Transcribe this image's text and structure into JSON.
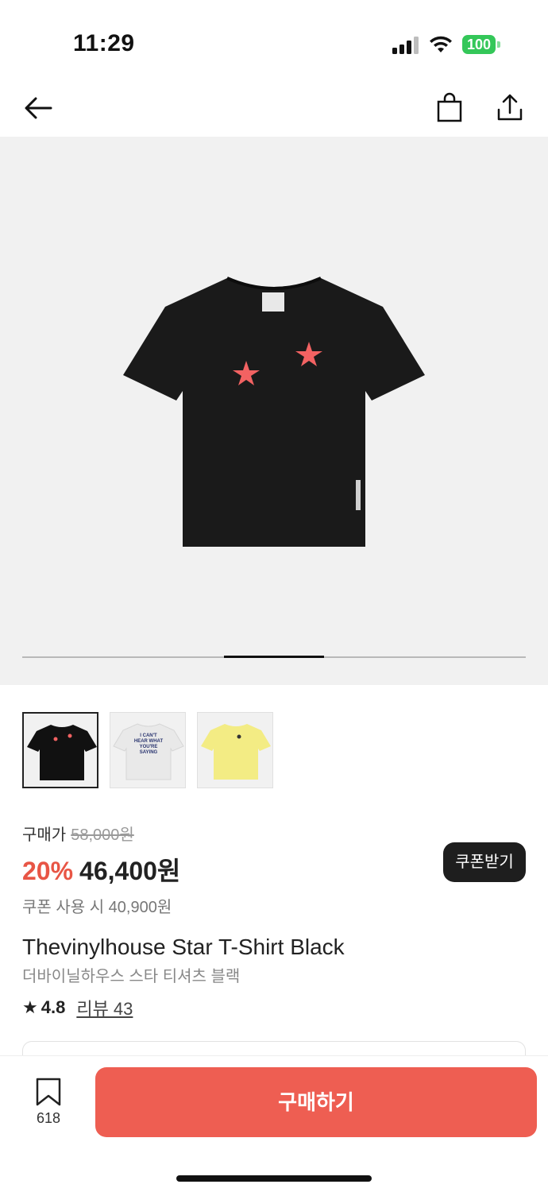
{
  "status_bar": {
    "time": "11:29",
    "battery": "100",
    "battery_color": "#34c759"
  },
  "nav": {
    "back_icon": "arrow-left-icon",
    "bag_icon": "shopping-bag-icon",
    "share_icon": "share-icon"
  },
  "hero": {
    "image_desc": "black t-shirt with two red stars",
    "carousel_position": 0.4
  },
  "thumbnails": [
    {
      "label": "black star tee",
      "selected": true,
      "print_text": ""
    },
    {
      "label": "white graphic tee",
      "selected": false,
      "print_text": "I CAN'T HEAR WHAT YOU'RE SAYING"
    },
    {
      "label": "yellow star tee",
      "selected": false,
      "print_text": ""
    }
  ],
  "price": {
    "label": "구매가",
    "original": "58,000원",
    "discount": "20%",
    "final": "46,400원",
    "coupon_text": "쿠폰 사용 시 40,900원",
    "coupon_button": "쿠폰받기",
    "accent_color": "#e85545"
  },
  "product": {
    "title": "Thevinylhouse Star T-Shirt Black",
    "subtitle": "더바이닐하우스 스타 티셔츠 블랙",
    "rating": "4.8",
    "review_label": "리뷰 43"
  },
  "bottom_bar": {
    "bookmark_count": "618",
    "buy_label": "구매하기",
    "buy_color": "#ee5e52"
  }
}
